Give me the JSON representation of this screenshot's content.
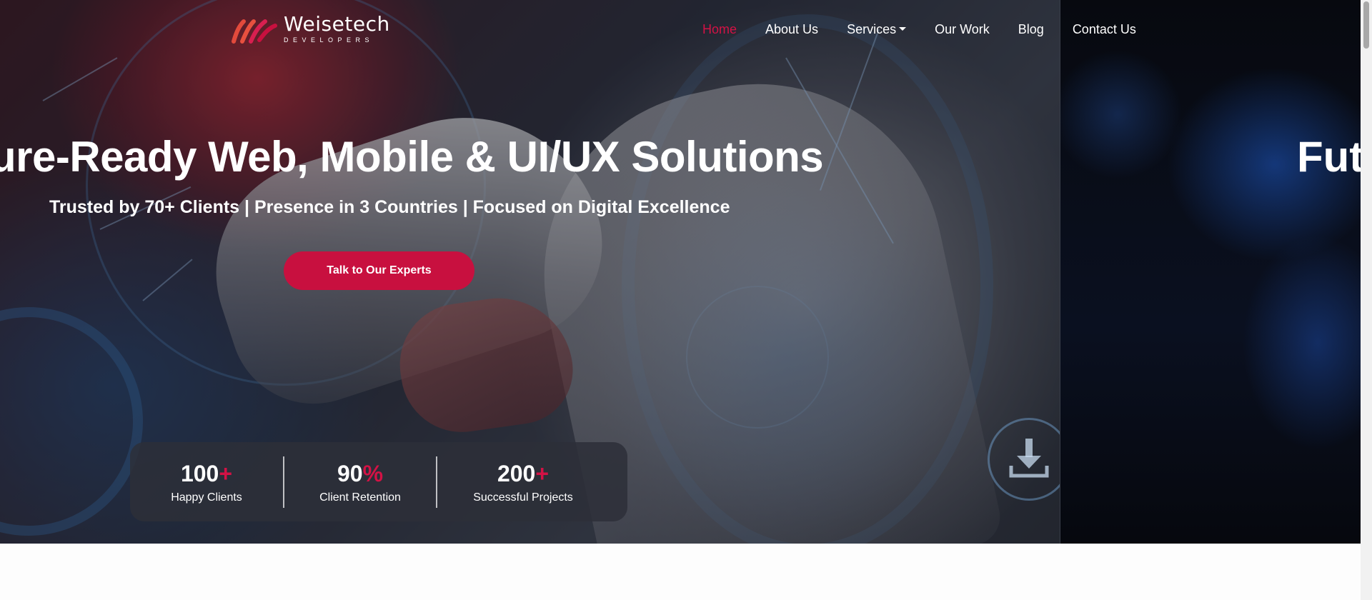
{
  "brand": {
    "name": "Weisetech",
    "tagline": "DEVELOPERS",
    "accent_color": "#c8103f",
    "logo_icon": "weisetech-logo-icon"
  },
  "nav": {
    "items": [
      {
        "label": "Home",
        "active": true
      },
      {
        "label": "About Us",
        "active": false
      },
      {
        "label": "Services",
        "active": false,
        "has_dropdown": true
      },
      {
        "label": "Our Work",
        "active": false
      },
      {
        "label": "Blog",
        "active": false
      },
      {
        "label": "Contact Us",
        "active": false
      }
    ]
  },
  "hero": {
    "headline": "ure-Ready Web, Mobile & UI/UX Solutions",
    "next_slide_headline": "Fut",
    "subheadline": "Trusted by 70+ Clients | Presence in 3 Countries | Focused on Digital Excellence",
    "cta_label": "Talk to Our Experts",
    "decor_icon": "download-icon"
  },
  "stats": [
    {
      "value": "100",
      "suffix": "+",
      "label": "Happy Clients"
    },
    {
      "value": "90",
      "suffix": "%",
      "label": "Client Retention"
    },
    {
      "value": "200",
      "suffix": "+",
      "label": "Successful Projects"
    }
  ]
}
